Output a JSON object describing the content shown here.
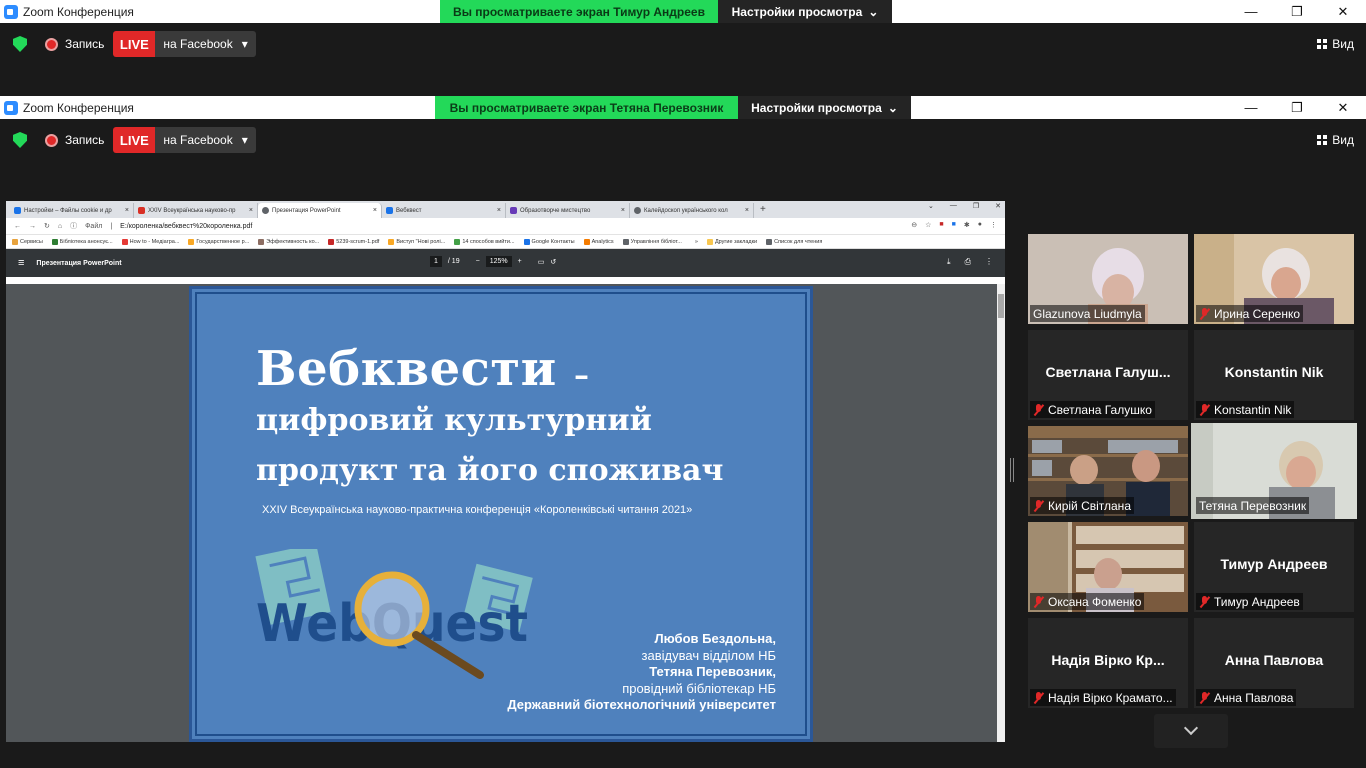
{
  "zoom_window_1": {
    "title": "Zoom Конференция",
    "share_banner": "Вы просматриваете экран Тимур Андреев",
    "view_settings": "Настройки просмотра",
    "record_label": "Запись",
    "live_label": "LIVE",
    "live_destination": "на Facebook",
    "view_label": "Вид"
  },
  "zoom_window_2": {
    "title": "Zoom Конференция",
    "share_banner": "Вы просматриваете экран Тетяна Перевозник",
    "view_settings": "Настройки просмотра",
    "record_label": "Запись",
    "live_label": "LIVE",
    "live_destination": "на Facebook",
    "view_label": "Вид"
  },
  "window_controls": {
    "minimize": "—",
    "restore": "❐",
    "close": "✕"
  },
  "browser": {
    "tabs": [
      {
        "label": "Настройки – Файлы cookie и др",
        "color": "#1a73e8"
      },
      {
        "label": "XXIV Всеукраїнська науково-пр",
        "color": "#d93025"
      },
      {
        "label": "Презентация PowerPoint",
        "color": "#5f6368"
      },
      {
        "label": "Вебквест",
        "color": "#1a73e8"
      },
      {
        "label": "Образотворче мистецтво",
        "color": "#673ab7"
      },
      {
        "label": "Калейдоскоп українського кол",
        "color": "#5f6368"
      }
    ],
    "address_prefix": "Файл",
    "address": "E:/короленка/вебквест%20короленка.pdf",
    "bookmarks": [
      {
        "label": "Сервисы",
        "color": "#e8a33d"
      },
      {
        "label": "Бібліотека анонсує...",
        "color": "#2e7d32"
      },
      {
        "label": "How to - Медіагра...",
        "color": "#e53935"
      },
      {
        "label": "Государственное р...",
        "color": "#f9a825"
      },
      {
        "label": "Эффективность ко...",
        "color": "#8d6e63"
      },
      {
        "label": "5239-scrum-1.pdf",
        "color": "#c62828"
      },
      {
        "label": "Виступ \"Нові ролі...",
        "color": "#f9a825"
      },
      {
        "label": "14 способов вийти...",
        "color": "#43a047"
      },
      {
        "label": "Google Контакты",
        "color": "#1a73e8"
      },
      {
        "label": "Analytics",
        "color": "#f57c00"
      },
      {
        "label": "Управління бібліот...",
        "color": "#5f6368"
      },
      {
        "label": "Другие закладки",
        "color": "#f9c74f"
      },
      {
        "label": "Список для чтения",
        "color": "#5f6368"
      }
    ],
    "pdf": {
      "title": "Презентация PowerPoint",
      "page_current": "1",
      "page_total": "/ 19",
      "zoom": "125%"
    }
  },
  "slide": {
    "title": "Вебквести",
    "title_dash": "–",
    "subtitle_line1": "цифровий культурний",
    "subtitle_line2": "продукт та його споживач",
    "conference": "XXIV Всеукраїнська науково-практична конференція «Короленківські читання 2021»",
    "logo_text": "WebQuest",
    "author1_name": "Любов Бездольна",
    "author1_role": "завідувач відділом НБ",
    "author2_name": "Тетяна Перевозник",
    "author2_role": "провідний бібліотекар НБ",
    "university": "Державний біотехнологічний університет"
  },
  "participants": [
    {
      "name": "Glazunova Liudmyla",
      "muted": false,
      "video": true
    },
    {
      "name": "Ирина Серенко",
      "muted": true,
      "video": true
    },
    {
      "big_name": "Светлана  Галуш...",
      "name": "Светлана Галушко",
      "muted": true,
      "video": false
    },
    {
      "big_name": "Konstantin Nik",
      "name": "Konstantin Nik",
      "muted": true,
      "video": false
    },
    {
      "name": "Кирій Світлана",
      "muted": true,
      "video": true
    },
    {
      "name": "Тетяна Перевозник",
      "muted": false,
      "video": true,
      "active": true
    },
    {
      "name": "Оксана Фоменко",
      "muted": true,
      "video": true
    },
    {
      "big_name": "Тимур Андреев",
      "name": "Тимур Андреев",
      "muted": true,
      "video": false
    },
    {
      "big_name": "Надія Вірко  Кр...",
      "name": "Надія Вірко Крамато...",
      "muted": true,
      "video": false
    },
    {
      "big_name": "Анна Павлова",
      "name": "Анна Павлова",
      "muted": true,
      "video": false
    }
  ]
}
